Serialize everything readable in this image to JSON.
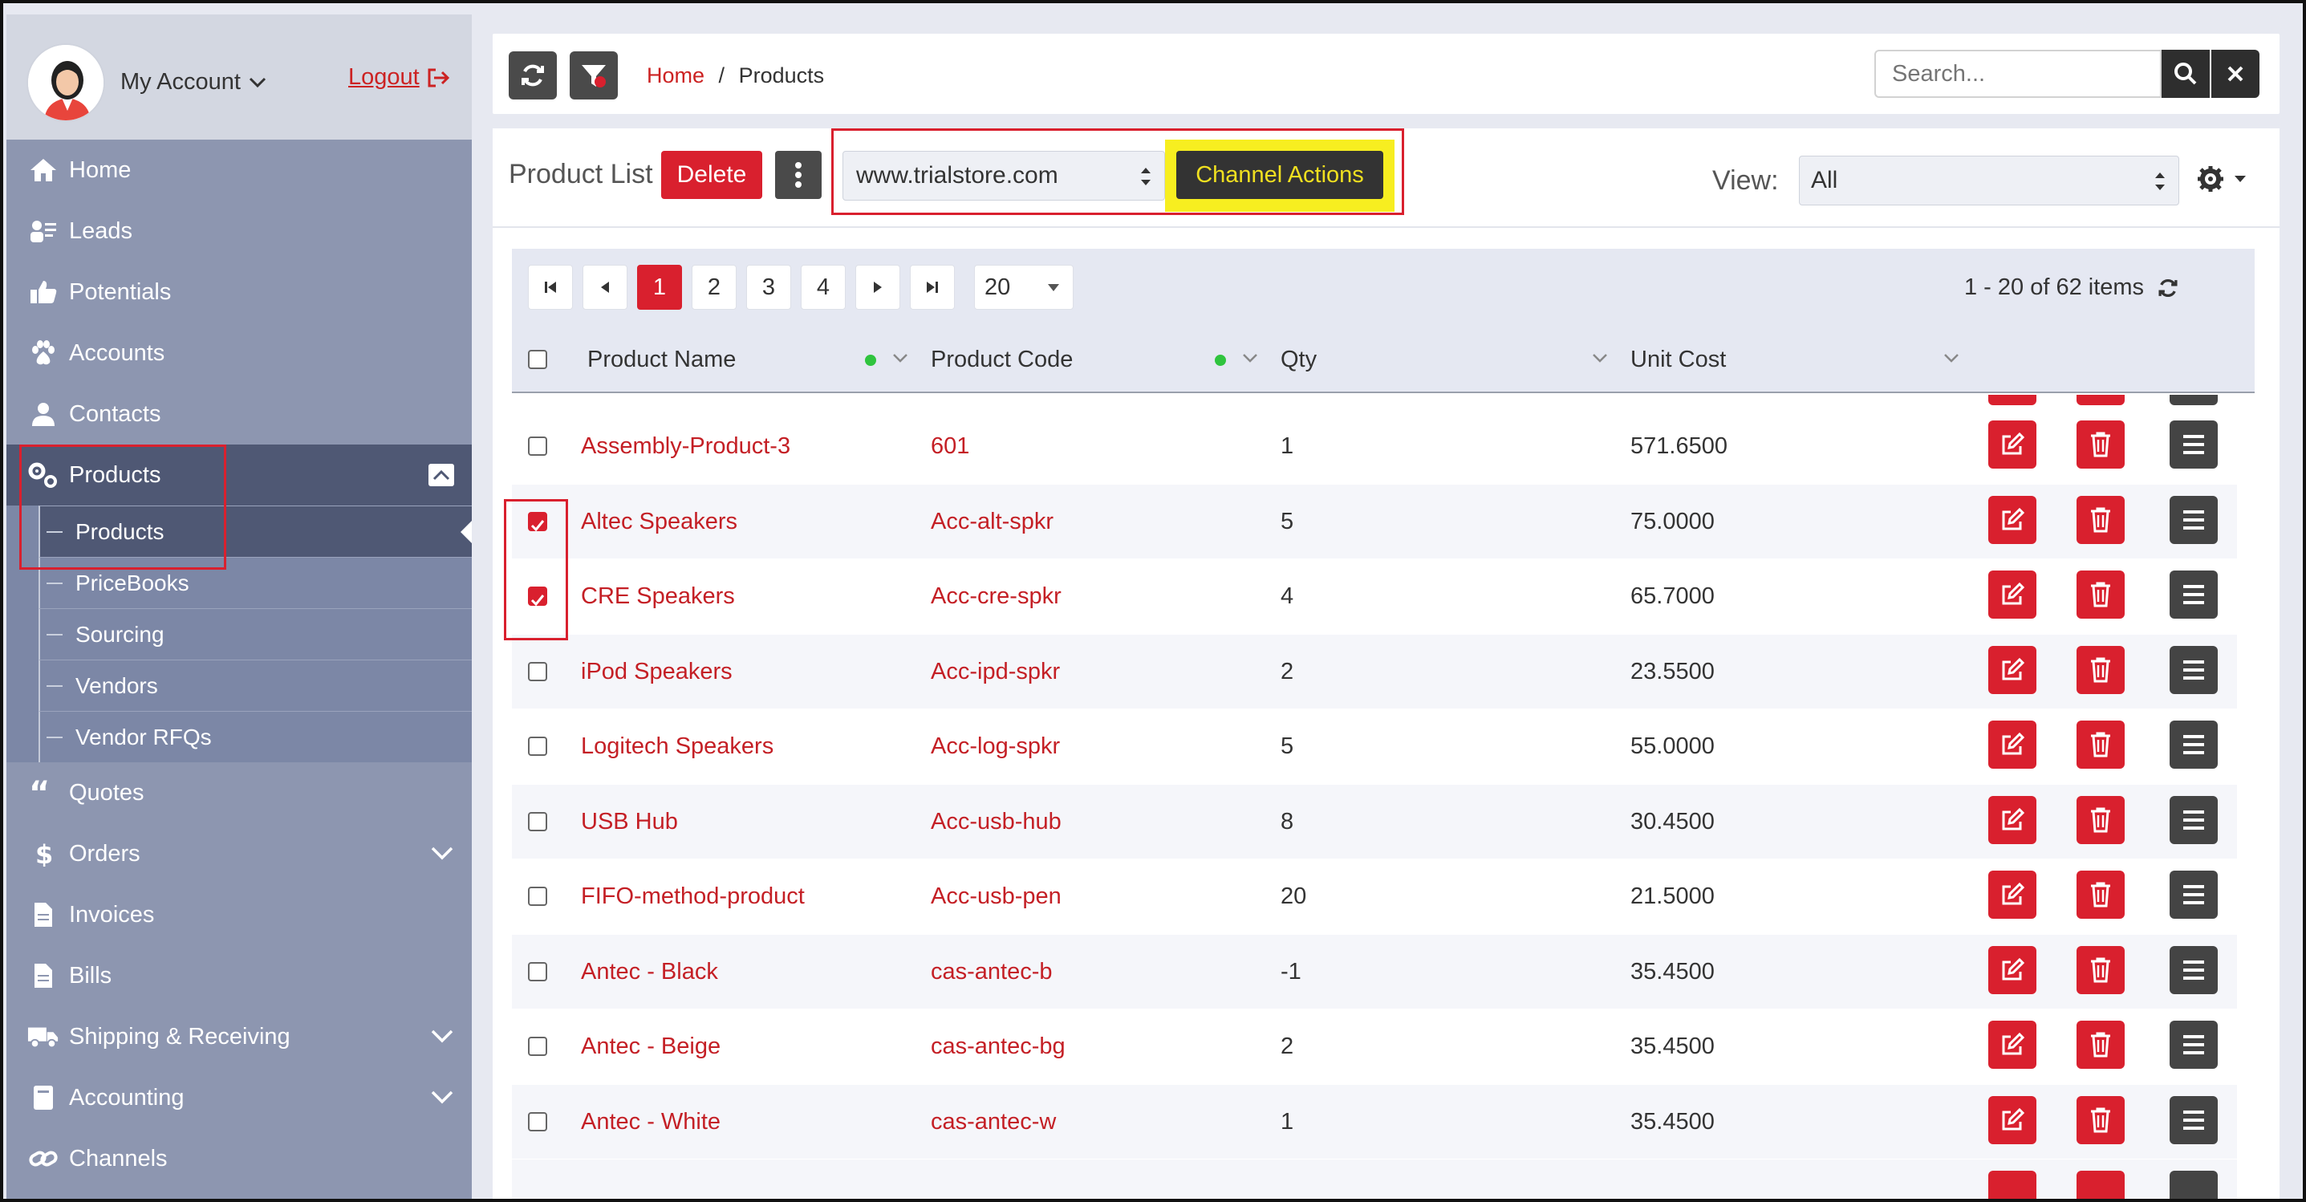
{
  "account": {
    "label": "My Account",
    "logout": "Logout"
  },
  "nav": {
    "home": "Home",
    "leads": "Leads",
    "potentials": "Potentials",
    "accounts": "Accounts",
    "contacts": "Contacts",
    "products": "Products",
    "products_sub": [
      "Products",
      "PriceBooks",
      "Sourcing",
      "Vendors",
      "Vendor RFQs"
    ],
    "quotes": "Quotes",
    "orders": "Orders",
    "invoices": "Invoices",
    "bills": "Bills",
    "shipping": "Shipping & Receiving",
    "accounting": "Accounting",
    "channels": "Channels"
  },
  "breadcrumb": {
    "home": "Home",
    "sep": "/",
    "current": "Products"
  },
  "search": {
    "placeholder": "Search..."
  },
  "toolbar": {
    "title": "Product List",
    "delete": "Delete",
    "channel": "www.trialstore.com",
    "channel_actions": "Channel Actions",
    "view_label": "View:",
    "view_value": "All"
  },
  "pager": {
    "pages": [
      "1",
      "2",
      "3",
      "4"
    ],
    "current": "1",
    "page_size": "20",
    "info": "1 - 20 of 62 items"
  },
  "columns": {
    "name": "Product Name",
    "code": "Product Code",
    "qty": "Qty",
    "cost": "Unit Cost"
  },
  "rows": [
    {
      "name": "Assembly-Product-3",
      "code": "601",
      "qty": "1",
      "cost": "571.6500",
      "checked": false
    },
    {
      "name": "Altec Speakers",
      "code": "Acc-alt-spkr",
      "qty": "5",
      "cost": "75.0000",
      "checked": true
    },
    {
      "name": "CRE Speakers",
      "code": "Acc-cre-spkr",
      "qty": "4",
      "cost": "65.7000",
      "checked": true
    },
    {
      "name": "iPod Speakers",
      "code": "Acc-ipd-spkr",
      "qty": "2",
      "cost": "23.5500",
      "checked": false
    },
    {
      "name": "Logitech Speakers",
      "code": "Acc-log-spkr",
      "qty": "5",
      "cost": "55.0000",
      "checked": false
    },
    {
      "name": "USB Hub",
      "code": "Acc-usb-hub",
      "qty": "8",
      "cost": "30.4500",
      "checked": false
    },
    {
      "name": "FIFO-method-product",
      "code": "Acc-usb-pen",
      "qty": "20",
      "cost": "21.5000",
      "checked": false
    },
    {
      "name": "Antec - Black",
      "code": "cas-antec-b",
      "qty": "-1",
      "cost": "35.4500",
      "checked": false
    },
    {
      "name": "Antec - Beige",
      "code": "cas-antec-bg",
      "qty": "2",
      "cost": "35.4500",
      "checked": false
    },
    {
      "name": "Antec - White",
      "code": "cas-antec-w",
      "qty": "1",
      "cost": "35.4500",
      "checked": false
    }
  ],
  "colors": {
    "accent": "#d9202e",
    "highlight": "#f7ee20",
    "sidebar": "#8d96b0"
  }
}
